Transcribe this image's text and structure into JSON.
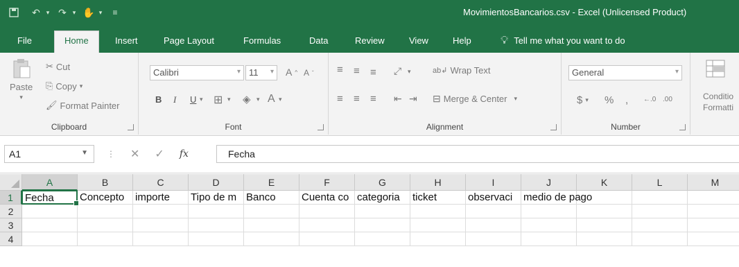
{
  "window": {
    "title": "MovimientosBancarios.csv  -  Excel (Unlicensed Product)"
  },
  "tabs": [
    "File",
    "Home",
    "Insert",
    "Page Layout",
    "Formulas",
    "Data",
    "Review",
    "View",
    "Help"
  ],
  "active_tab": "Home",
  "tell_me": "Tell me what you want to do",
  "ribbon": {
    "clipboard": {
      "label": "Clipboard",
      "paste": "Paste",
      "cut": "Cut",
      "copy": "Copy",
      "format_painter": "Format Painter"
    },
    "font": {
      "label": "Font",
      "name": "Calibri",
      "size": "11",
      "bold": "B",
      "italic": "I",
      "underline": "U"
    },
    "alignment": {
      "label": "Alignment",
      "wrap_text": "Wrap Text",
      "merge_center": "Merge & Center"
    },
    "number": {
      "label": "Number",
      "format": "General",
      "currency": "$",
      "percent": "%",
      "comma": ",",
      "inc_dec": "←.0",
      "dec_dec": ".00"
    },
    "styles": {
      "conditional_formatting": "Conditio",
      "formatting": "Formatti"
    }
  },
  "formula_bar": {
    "name_box": "A1",
    "fx": "fx",
    "formula": "Fecha"
  },
  "grid": {
    "columns": [
      "A",
      "B",
      "C",
      "D",
      "E",
      "F",
      "G",
      "H",
      "I",
      "J",
      "K",
      "L",
      "M"
    ],
    "rows": [
      "1",
      "2",
      "3",
      "4"
    ],
    "selected_column": "A",
    "selected_row": "1",
    "row1": [
      "Fecha",
      "Concepto",
      "importe",
      "Tipo de m",
      "Banco",
      "Cuenta co",
      "categoria",
      "ticket",
      "observaci",
      "medio de pago",
      "",
      "",
      ""
    ]
  },
  "colors": {
    "accent": "#217346"
  }
}
